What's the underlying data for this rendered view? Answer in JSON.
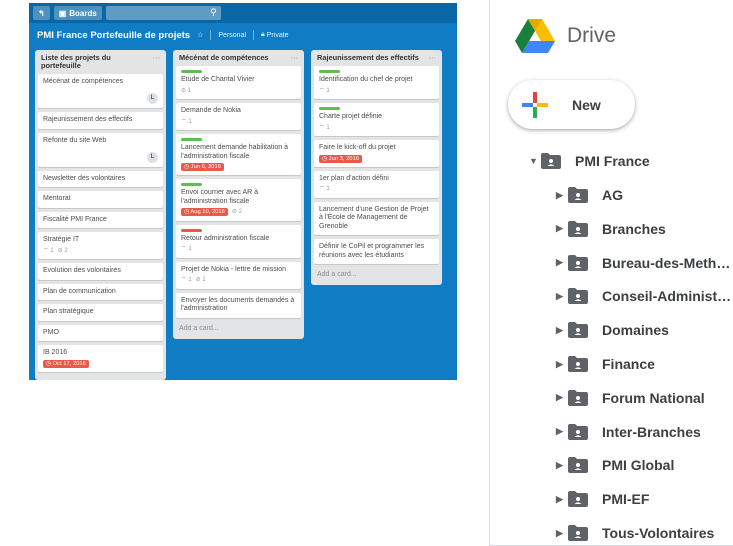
{
  "trello": {
    "board_button": "Boards",
    "board_title": "PMI France Portefeuille de projets",
    "visibility_team": "Personal",
    "visibility_private": "Private",
    "lists": [
      {
        "title": "Liste des projets du portefeuille",
        "cards": [
          {
            "text": "Mécénat de compétences",
            "avatar": "L",
            "tall": true
          },
          {
            "text": "Rajeunissement des effectifs"
          },
          {
            "text": "Refonte du site Web",
            "avatar": "L",
            "tall": true
          },
          {
            "text": "Newsletter des volontaires"
          },
          {
            "text": "Mentorat"
          },
          {
            "text": "Fiscalité PMI France"
          },
          {
            "text": "Stratégie IT",
            "comments": "1",
            "attachments": "2"
          },
          {
            "text": "Evolution des volontaires"
          },
          {
            "text": "Plan de communication"
          },
          {
            "text": "Plan stratégique"
          },
          {
            "text": "PMO"
          },
          {
            "text": "IB 2016",
            "due": "Oct 17, 2016"
          }
        ]
      },
      {
        "title": "Mécénat de compétences",
        "cards": [
          {
            "text": "Etude de Chantal Vivier",
            "label": "green",
            "attachments": "1"
          },
          {
            "text": "Demande de Nokia",
            "comments": "1"
          },
          {
            "text": "Lancement demande habilitation à l'administration fiscale",
            "label": "green",
            "due": "Jun 6, 2016"
          },
          {
            "text": "Envoi courrier avec AR à l'administration fiscale",
            "label": "green",
            "due": "Aug 10, 2016",
            "attachments": "2"
          },
          {
            "text": "Retour administration fiscale",
            "label": "red",
            "comments": "1"
          },
          {
            "text": "Projet de Nokia - lettre de mission",
            "comments": "1",
            "attachments": "1"
          },
          {
            "text": "Envoyer les documents demandés à l'administration"
          }
        ],
        "add_card": "Add a card..."
      },
      {
        "title": "Rajeunissement des effectifs",
        "cards": [
          {
            "text": "Identification du chef de projet",
            "label": "green",
            "comments": "1"
          },
          {
            "text": "Charte projet définie",
            "label": "green",
            "comments": "1"
          },
          {
            "text": "Faire le kick-off du projet",
            "due": "Jun 3, 2016"
          },
          {
            "text": "1er plan d'action défini",
            "comments": "1"
          },
          {
            "text": "Lancement d'une Gestion de Projet à l'Ecole de Management de Grenoble"
          },
          {
            "text": "Définir le CoPil et programmer les réunions avec les étudiants"
          }
        ],
        "add_card": "Add a card..."
      }
    ]
  },
  "drive": {
    "logo_text": "Drive",
    "new_button": "New",
    "root_folder": "PMI France",
    "folders": [
      "AG",
      "Branches",
      "Bureau-des-Meth…",
      "Conseil-Administ…",
      "Domaines",
      "Finance",
      "Forum National",
      "Inter-Branches",
      "PMI Global",
      "PMI-EF",
      "Tous-Volontaires"
    ]
  },
  "colors": {
    "trello_board": "#0f7cc4",
    "trello_topbar": "#0a67a6",
    "label_green": "#61bd4f",
    "label_red": "#eb5a46",
    "drive_text": "#3c4043",
    "drive_folder": "#5f6368"
  }
}
